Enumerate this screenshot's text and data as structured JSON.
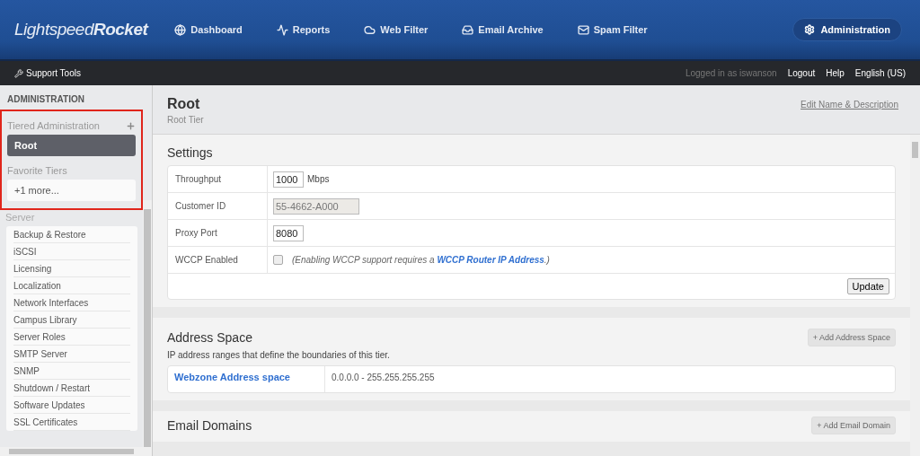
{
  "header": {
    "logo_light": "Lightspeed",
    "logo_bold": "Rocket",
    "nav": [
      {
        "kind": "globe",
        "label": "Dashboard"
      },
      {
        "kind": "pulse",
        "label": "Reports"
      },
      {
        "kind": "cloud",
        "label": "Web Filter"
      },
      {
        "kind": "inbox",
        "label": "Email Archive"
      },
      {
        "kind": "mail",
        "label": "Spam Filter"
      }
    ],
    "admin_button": "Administration"
  },
  "subbar": {
    "support_tools": "Support Tools",
    "logged_in": "Logged in as iswanson",
    "links": [
      "Logout",
      "Help",
      "English (US)"
    ]
  },
  "sidebar": {
    "title": "ADMINISTRATION",
    "tiered_title": "Tiered Administration",
    "tiers": [
      {
        "label": "Root",
        "selected": true
      }
    ],
    "favorites_title": "Favorite Tiers",
    "favorites": [
      "+1 more..."
    ],
    "server_title": "Server",
    "server_items": [
      "Backup & Restore",
      "iSCSI",
      "Licensing",
      "Localization",
      "Network Interfaces",
      "Campus Library",
      "Server Roles",
      "SMTP Server",
      "SNMP",
      "Shutdown / Restart",
      "Software Updates",
      "SSL Certificates"
    ]
  },
  "page": {
    "title": "Root",
    "subtitle": "Root Tier",
    "edit_link": "Edit Name & Description"
  },
  "settings": {
    "title": "Settings",
    "rows": [
      {
        "kind": "input",
        "label": "Throughput",
        "value": "1000",
        "unit": "Mbps",
        "disabled": false
      },
      {
        "kind": "input",
        "label": "Customer ID",
        "value": "55-4662-A000",
        "disabled": true
      },
      {
        "kind": "input",
        "label": "Proxy Port",
        "value": "8080",
        "disabled": false
      },
      {
        "kind": "checkbox",
        "label": "WCCP Enabled",
        "checked": false,
        "note_before": "(Enabling WCCP support requires a ",
        "link": "WCCP Router IP Address",
        "note_after": ".)"
      }
    ],
    "update_button": "Update"
  },
  "address_space": {
    "title": "Address Space",
    "add_button": "+ Add Address Space",
    "description": "IP address ranges that define the boundaries of this tier.",
    "rows": [
      {
        "name": "Webzone Address space",
        "range": "0.0.0.0 - 255.255.255.255"
      }
    ]
  },
  "email_domains": {
    "title": "Email Domains",
    "add_button": "+ Add Email Domain"
  }
}
